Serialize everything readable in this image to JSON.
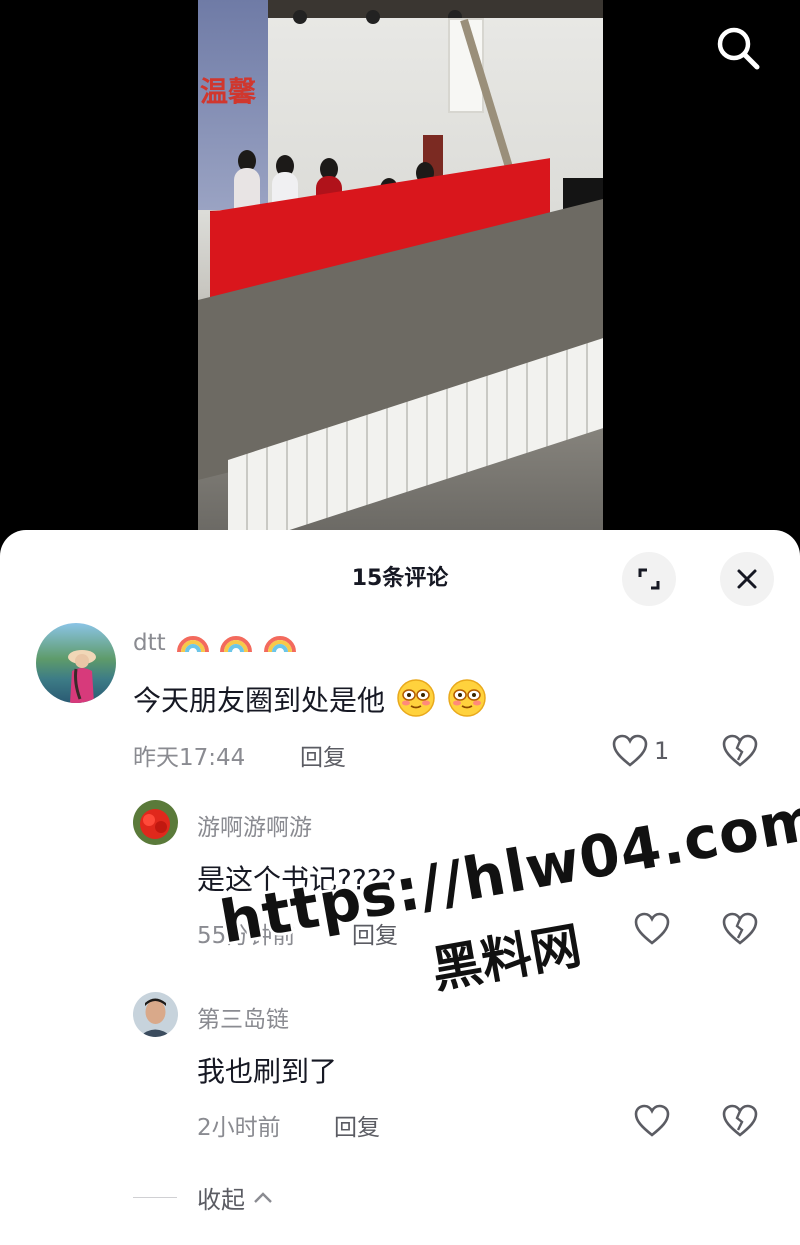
{
  "header": {
    "search_icon": "search-icon"
  },
  "video": {
    "sign_text": "温馨"
  },
  "comments_panel": {
    "title": "15条评论",
    "expand_icon": "expand-icon",
    "close_icon": "close-icon",
    "comments": [
      {
        "username": "dtt",
        "username_emoji": "rainbow-emoji x3",
        "text": "今天朋友圈到处是他",
        "text_emoji": "blush-emoji x2",
        "time": "昨天17:44",
        "reply_label": "回复",
        "like_count": "1"
      },
      {
        "username": "游啊游啊游",
        "text": "是这个书记????",
        "time": "55分钟前",
        "reply_label": "回复",
        "like_count": ""
      },
      {
        "username": "第三岛链",
        "text": "我也刷到了",
        "time": "2小时前",
        "reply_label": "回复",
        "like_count": ""
      }
    ],
    "collapse_label": "收起"
  },
  "watermark": {
    "url": "https://hlw04.com",
    "site_name": "黑料网"
  }
}
